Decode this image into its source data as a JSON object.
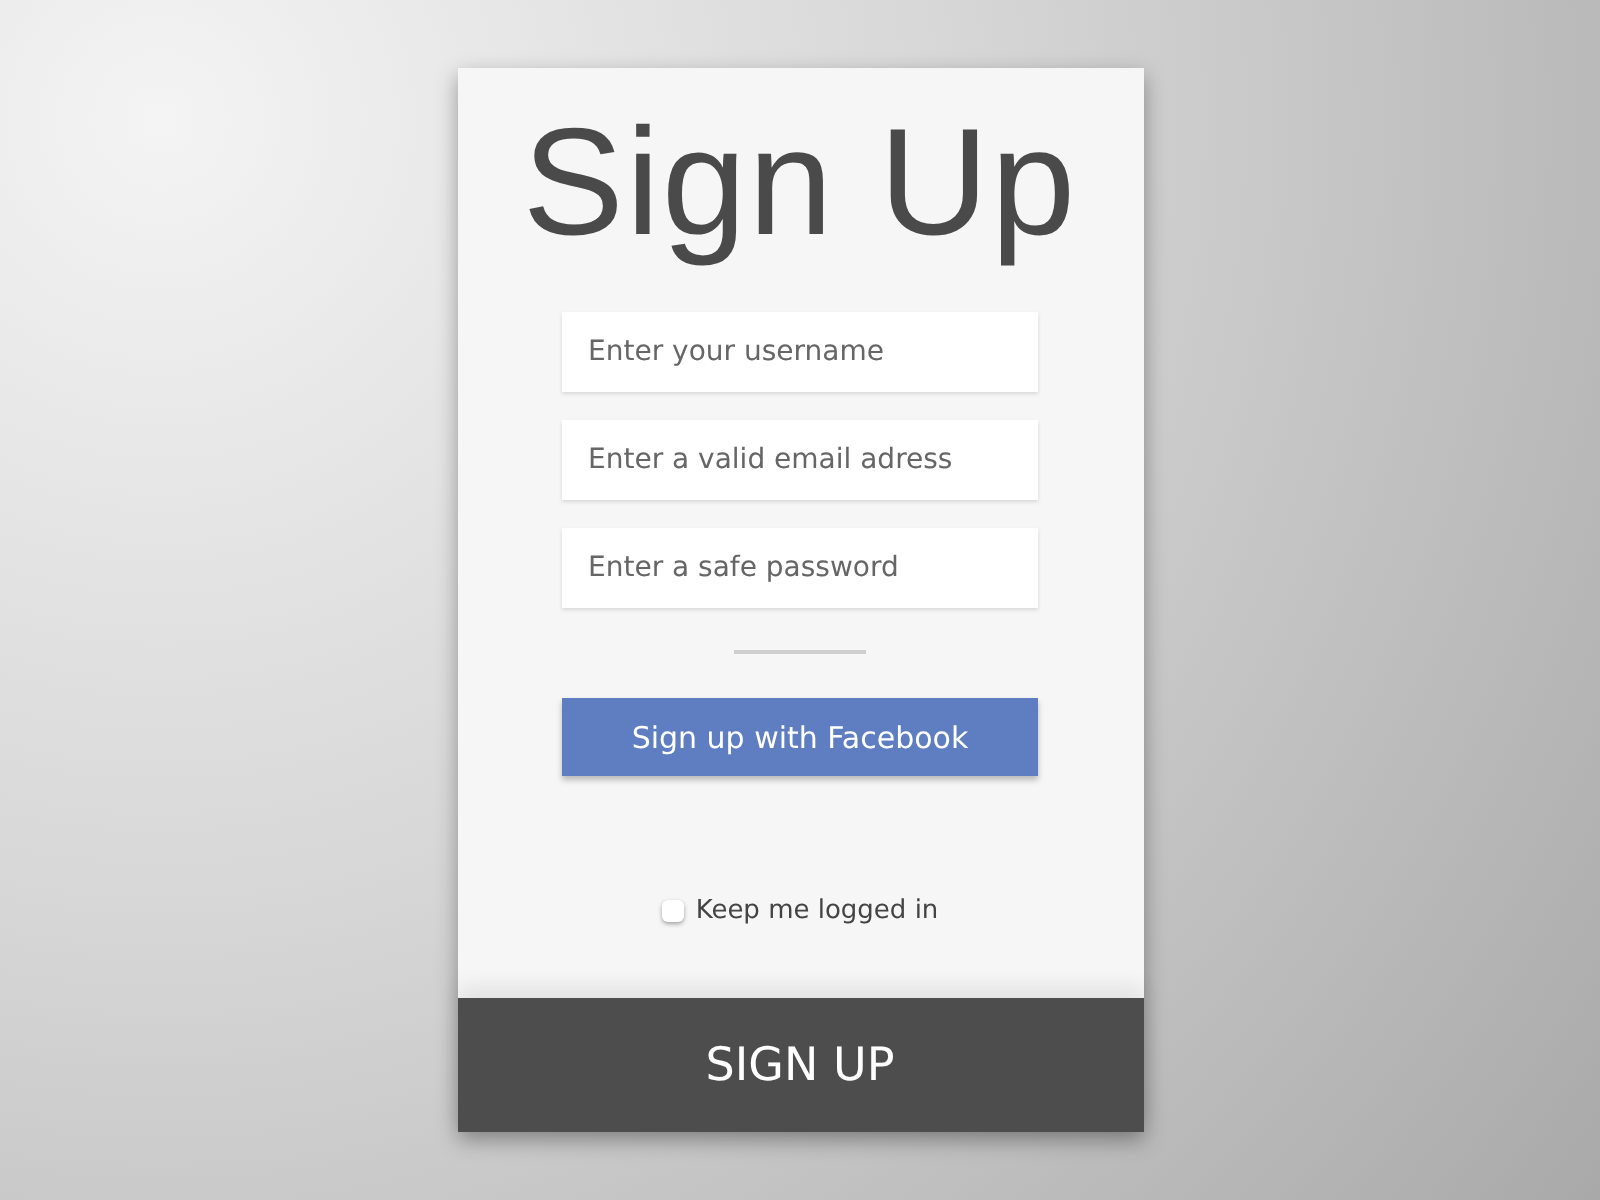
{
  "title": "Sign Up",
  "fields": [
    {
      "placeholder": "Enter your username"
    },
    {
      "placeholder": "Enter a valid email adress"
    },
    {
      "placeholder": "Enter a safe password"
    }
  ],
  "facebook_button": "Sign up with Facebook",
  "remember": {
    "label": "Keep me logged in",
    "checked": false
  },
  "submit_button": "SIGN UP"
}
